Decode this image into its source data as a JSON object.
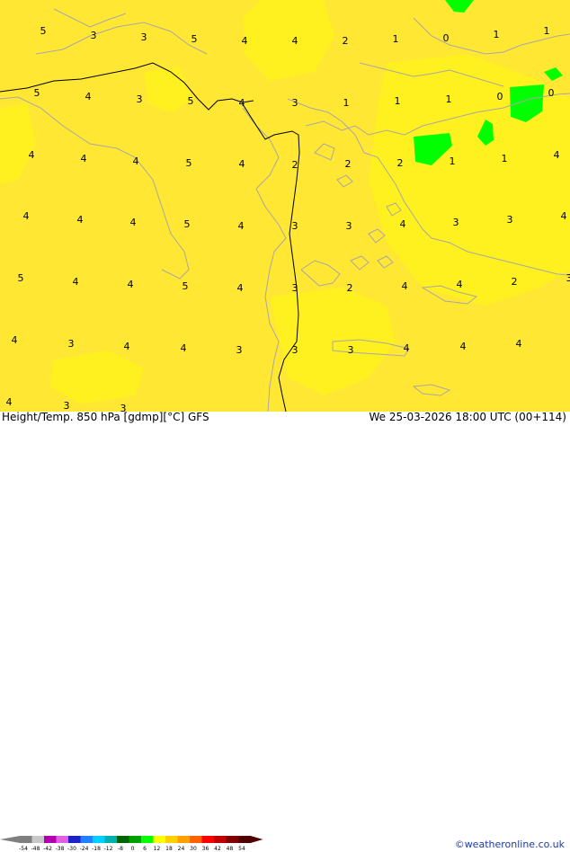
{
  "map": {
    "colors": {
      "base": "#ffe733",
      "warm": "#fff01f",
      "cool": "#ffd831",
      "green": "#00ff00",
      "coast": "#a8a8a8",
      "border": "#000000"
    },
    "values": [
      "5",
      "3",
      "3",
      "5",
      "4",
      "4",
      "2",
      "1",
      "0",
      "1",
      "1",
      "5",
      "4",
      "3",
      "5",
      "4",
      "3",
      "1",
      "1",
      "1",
      "0",
      "0",
      "4",
      "4",
      "4",
      "5",
      "4",
      "2",
      "2",
      "2",
      "1",
      "1",
      "4",
      "4",
      "4",
      "4",
      "5",
      "4",
      "3",
      "3",
      "4",
      "3",
      "3",
      "4",
      "5",
      "4",
      "4",
      "5",
      "4",
      "3",
      "2",
      "4",
      "4",
      "2",
      "3",
      "4",
      "3",
      "4",
      "4",
      "3",
      "3",
      "3",
      "4",
      "4",
      "4",
      "4",
      "3",
      "3"
    ]
  },
  "footer": {
    "left_title": "Height/Temp. 850 hPa [gdmp][°C] GFS",
    "run": "We 25-03-2026 18:00 UTC (00+114)",
    "credit": "©weatheronline.co.uk",
    "legend_ticks": [
      "-54",
      "-48",
      "-42",
      "-38",
      "-30",
      "-24",
      "-18",
      "-12",
      "-8",
      "0",
      "6",
      "12",
      "18",
      "24",
      "30",
      "36",
      "42",
      "48",
      "54"
    ],
    "legend_colors": [
      "#7f7f7f",
      "#c8c8c8",
      "#b000b0",
      "#e060e0",
      "#2020c8",
      "#2080ff",
      "#00d0ff",
      "#00b0b0",
      "#006400",
      "#00a000",
      "#00ff00",
      "#ffff00",
      "#ffd000",
      "#ffa000",
      "#ff6000",
      "#ff0000",
      "#c00000",
      "#800000",
      "#500000"
    ]
  }
}
